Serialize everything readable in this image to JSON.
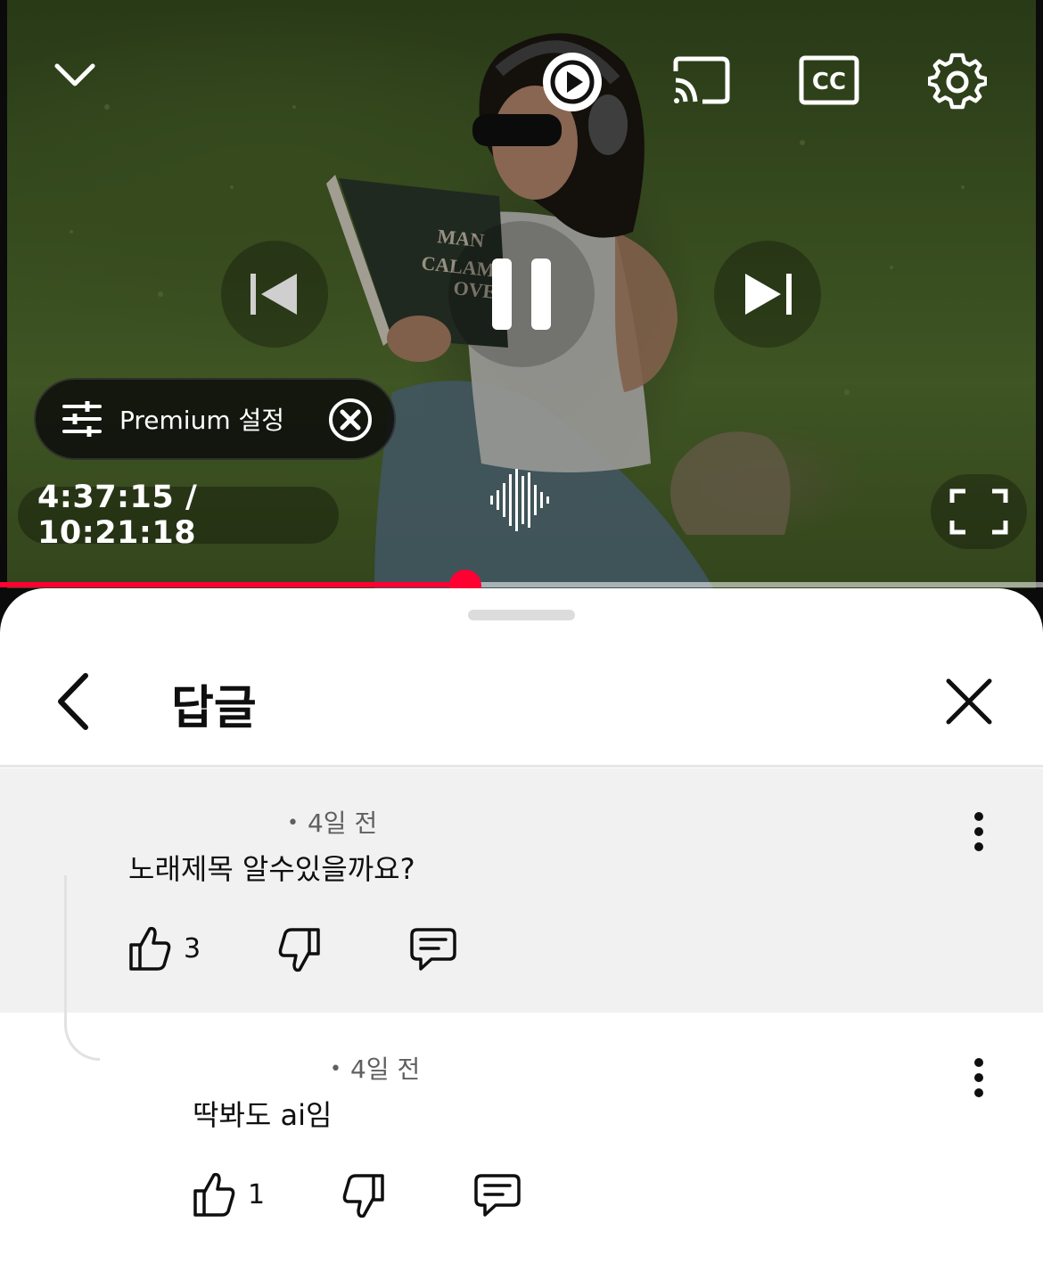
{
  "player": {
    "time_current": "4:37:15",
    "time_total": "10:21:18",
    "time_display": "4:37:15 / 10:21:18",
    "progress_fraction": 0.446,
    "premium_chip_label": "Premium 설정",
    "book_cover_text": [
      "MAN",
      "CALAMD",
      "OVE"
    ],
    "icons": {
      "collapse": "chevron-down-icon",
      "autoplay": "autoplay-icon",
      "cast": "cast-icon",
      "captions": "cc-icon",
      "settings": "gear-icon",
      "previous": "skip-previous-icon",
      "play_pause": "pause-icon",
      "next": "skip-next-icon",
      "fullscreen": "fullscreen-icon"
    },
    "accent_color": "#ff0033"
  },
  "sheet": {
    "title": "답글",
    "comments": [
      {
        "author": "",
        "time": "4일 전",
        "text": "노래제목 알수있을까요?",
        "likes": "3",
        "highlighted": true
      },
      {
        "author": "",
        "time": "4일 전",
        "text": "딱봐도 ai임",
        "likes": "1",
        "highlighted": false
      }
    ]
  }
}
